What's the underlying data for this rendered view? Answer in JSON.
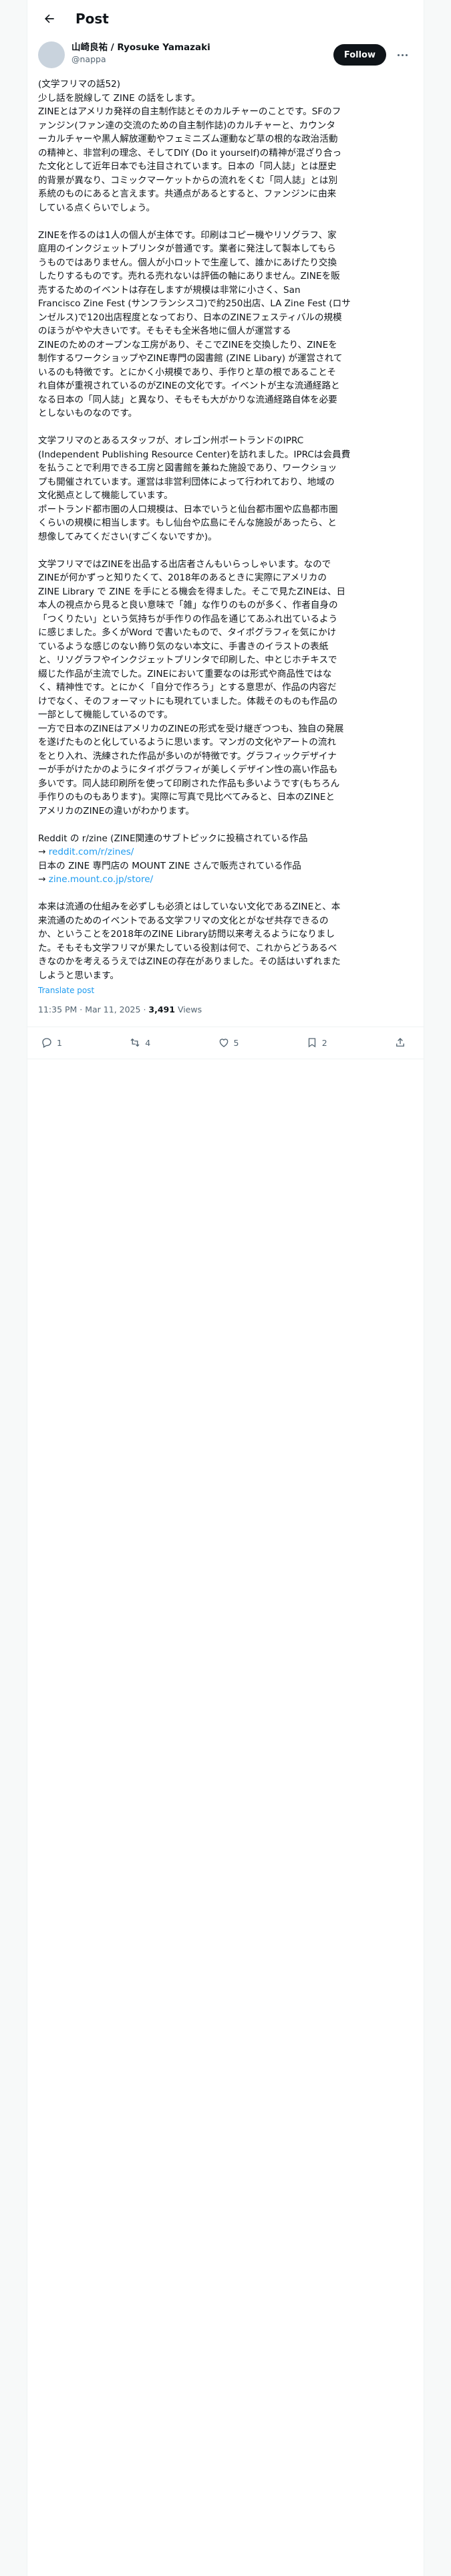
{
  "header": {
    "title": "Post"
  },
  "author": {
    "display_name": "山崎良祐 / Ryosuke Yamazaki",
    "handle": "@nappa",
    "follow_label": "Follow"
  },
  "post": {
    "paragraphs": [
      [
        "(文学フリマの話52)",
        "少し話を脱線して ZINE の話をします。",
        "ZINEとはアメリカ発祥の自主制作誌とそのカルチャーのことです。SFのフ",
        "ァンジン(ファン達の交流のための自主制作誌)のカルチャーと、カウンタ",
        "ーカルチャーや黒人解放運動やフェミニズム運動など草の根的な政治活動",
        "の精神と、非営利の理念、そしてDIY (Do it yourself)の精神が混ざり合っ",
        "た文化として近年日本でも注目されています。日本の「同人誌」とは歴史",
        "的背景が異なり、コミックマーケットからの流れをくむ「同人誌」とは別",
        "系統のものにあると言えます。共通点があるとすると、ファンジンに由来",
        "している点くらいでしょう。"
      ],
      [
        "ZINEを作るのは1人の個人が主体です。印刷はコピー機やリソグラフ、家",
        "庭用のインクジェットプリンタが普通です。業者に発注して製本してもら",
        "うものではありません。個人が小ロットで生産して、誰かにあげたり交換",
        "したりするものです。売れる売れないは評価の軸にありません。ZINEを販",
        "売するためのイベントは存在しますが規模は非常に小さく、San",
        "Francisco Zine Fest (サンフランシスコ)で約250出店、LA Zine Fest (ロサ",
        "ンゼルス)で120出店程度となっており、日本のZINEフェスティバルの規模",
        "のほうがやや大きいです。そもそも全米各地に個人が運営する",
        "ZINEのためのオープンな工房があり、そこでZINEを交換したり、ZINEを",
        "制作するワークショップやZINE専門の図書館 (ZINE Libary) が運営されて",
        "いるのも特徴です。とにかく小規模であり、手作りと草の根であることそ",
        "れ自体が重視されているのがZINEの文化です。イベントが主な流通経路と",
        "なる日本の「同人誌」と異なり、そもそも大がかりな流通経路自体を必要",
        "としないものなのです。"
      ],
      [
        "文学フリマのとあるスタッフが、オレゴン州ポートランドのIPRC",
        "(Independent Publishing Resource Center)を訪れました。IPRCは会員費",
        "を払うことで利用できる工房と図書館を兼ねた施設であり、ワークショッ",
        "プも開催されています。運営は非営利団体によって行われており、地域の",
        "文化拠点として機能しています。",
        "ポートランド都市圏の人口規模は、日本でいうと仙台都市圏や広島都市圏",
        "くらいの規模に相当します。もし仙台や広島にそんな施設があったら、と",
        "想像してみてください(すごくないですか)。"
      ],
      [
        "文学フリマではZINEを出品する出店者さんもいらっしゃいます。なので",
        "ZINEが何かずっと知りたくて、2018年のあるときに実際にアメリカの",
        "ZINE Library で ZINE を手にとる機会を得ました。そこで見たZINEは、日",
        "本人の視点から見ると良い意味で「雑」な作りのものが多く、作者自身の",
        "「つくりたい」という気持ちが手作りの作品を通じてあふれ出ているよう",
        "に感じました。多くがWord で書いたもので、タイポグラフィを気にかけ",
        "ているような感じのない飾り気のない本文に、手書きのイラストの表紙",
        "と、リソグラフやインクジェットプリンタで印刷した、中とじホチキスで",
        "綴じた作品が主流でした。ZINEにおいて重要なのは形式や商品性ではな",
        "く、精神性です。とにかく「自分で作ろう」とする意思が、作品の内容だ",
        "けでなく、そのフォーマットにも現れていました。体裁そのものも作品の",
        "一部として機能しているのです。",
        "一方で日本のZINEはアメリカのZINEの形式を受け継ぎつつも、独自の発展",
        "を遂げたものと化しているように思います。マンガの文化やアートの流れ",
        "をとり入れ、洗練された作品が多いのが特徴です。グラフィックデザイナ",
        "ーが手がけたかのようにタイポグラフィが美しくデザイン性の高い作品も",
        "多いです。同人誌印刷所を使って印刷された作品も多いようです(もちろん",
        "手作りのものもあります)。実際に写真で見比べてみると、日本のZINEと",
        "アメリカのZINEの違いがわかります。"
      ],
      [
        "Reddit の r/zine (ZINE関連のサブトピックに投稿されている作品",
        "→ reddit.com/r/zines/",
        "日本の ZINE 専門店の MOUNT ZINE さんで販売されている作品",
        "→ zine.mount.co.jp/store/"
      ],
      [
        "本来は流通の仕組みを必ずしも必須とはしていない文化であるZINEと、本",
        "来流通のためのイベントである文学フリマの文化とがなぜ共存できるの",
        "か、ということを2018年のZINE Library訪問以来考えるようになりまし",
        "た。そもそも文学フリマが果たしている役割は何で、これからどうあるべ",
        "きなのかを考えるうえではZINEの存在がありました。その話はいずれまた",
        "しようと思います。"
      ]
    ],
    "translate_label": "Translate post",
    "time": "11:35 PM · Mar 11, 2025",
    "views_count": "3,491",
    "views_label": "Views"
  },
  "actions": {
    "reply": "1",
    "repost": "4",
    "like": "5",
    "bookmark": "2"
  }
}
